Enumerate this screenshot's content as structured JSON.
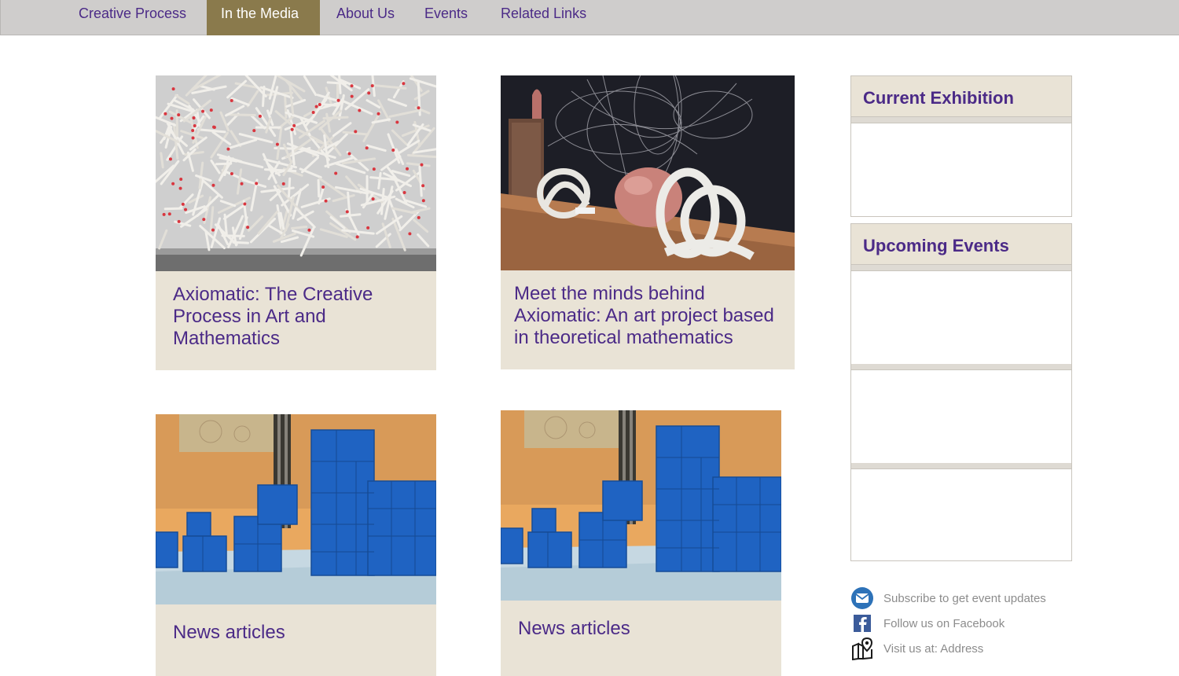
{
  "nav": {
    "items": [
      "Creative Process",
      "In the Media",
      "About Us",
      "Events",
      "Related Links"
    ],
    "active": "In the Media"
  },
  "cards": [
    {
      "title": "Axiomatic: The Creative Process in Art and Mathematics"
    },
    {
      "title": "Meet the minds behind Axiomatic: An art project based in theoretical mathematics"
    },
    {
      "title": "News articles"
    },
    {
      "title": "News articles"
    }
  ],
  "sidebar": {
    "current_exhibition": {
      "heading": "Current Exhibition"
    },
    "upcoming_events": {
      "heading": "Upcoming Events"
    }
  },
  "contact": {
    "subscribe": {
      "label": "Subscribe to get event updates",
      "icon": "mail-icon"
    },
    "facebook": {
      "label": "Follow us on Facebook",
      "icon": "facebook-icon"
    },
    "visit": {
      "label": "Visit us at: Address",
      "icon": "map-pin-icon"
    }
  },
  "colors": {
    "accent_purple": "#4b2a87",
    "nav_bg": "#cfcdcc",
    "active_tab": "#8a7a4c",
    "caption_bg": "#e9e3d6"
  }
}
